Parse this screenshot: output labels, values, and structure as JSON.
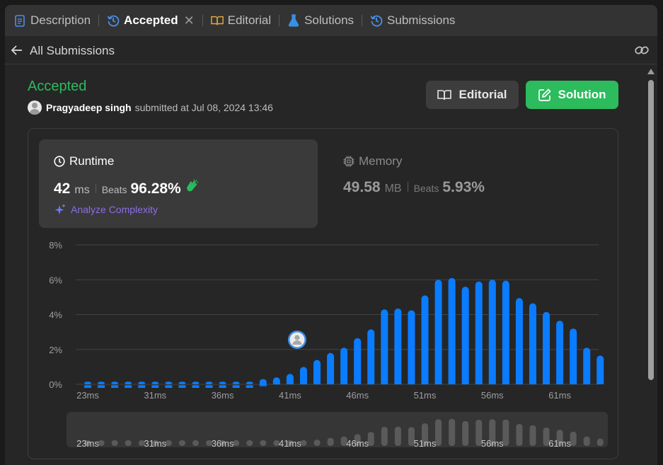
{
  "tabs": [
    {
      "label": "Description",
      "icon": "description-icon",
      "active": false
    },
    {
      "label": "Accepted",
      "icon": "history-icon",
      "active": true
    },
    {
      "label": "Editorial",
      "icon": "book-icon",
      "active": false
    },
    {
      "label": "Solutions",
      "icon": "flask-icon",
      "active": false
    },
    {
      "label": "Submissions",
      "icon": "history-icon",
      "active": false
    }
  ],
  "subheader": {
    "back_label": "All Submissions"
  },
  "submission": {
    "status": "Accepted",
    "username": "Pragyadeep singh",
    "submitted_text": "submitted at Jul 08, 2024 13:46"
  },
  "buttons": {
    "editorial": "Editorial",
    "solution": "Solution"
  },
  "runtime": {
    "title": "Runtime",
    "value": "42",
    "unit": "ms",
    "beats_label": "Beats",
    "beats_value": "96.28%",
    "analyze": "Analyze Complexity"
  },
  "memory": {
    "title": "Memory",
    "value": "49.58",
    "unit": "MB",
    "beats_label": "Beats",
    "beats_value": "5.93%"
  },
  "colors": {
    "accent_green": "#2cbb5d",
    "bar_blue": "#0a7cff",
    "purple": "#8a6ee8"
  },
  "chart_data": {
    "type": "bar",
    "y_ticks": [
      "0%",
      "2%",
      "4%",
      "6%",
      "8%"
    ],
    "ylim": [
      0,
      8
    ],
    "x_tick_labels": [
      "23ms",
      "31ms",
      "36ms",
      "41ms",
      "46ms",
      "51ms",
      "56ms",
      "61ms"
    ],
    "x_tick_indices": [
      0,
      5,
      10,
      15,
      20,
      25,
      30,
      35
    ],
    "user_bar_index": 16,
    "grid": true,
    "values": [
      0.15,
      0.15,
      0.15,
      0.15,
      0.15,
      0.15,
      0.15,
      0.15,
      0.15,
      0.15,
      0.15,
      0.15,
      0.15,
      0.3,
      0.4,
      0.6,
      1.0,
      1.4,
      1.8,
      2.1,
      2.65,
      3.15,
      4.3,
      4.35,
      4.25,
      5.1,
      6.0,
      6.1,
      5.6,
      5.9,
      6.0,
      5.95,
      4.95,
      4.65,
      4.15,
      3.65,
      3.2,
      2.1,
      1.65
    ]
  }
}
